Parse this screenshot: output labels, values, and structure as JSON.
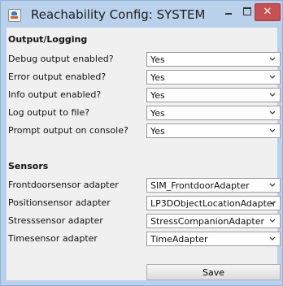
{
  "window": {
    "title": "Reachability Config: SYSTEM"
  },
  "titlebar": {
    "close_glyph": "✕"
  },
  "output_logging": {
    "heading": "Output/Logging",
    "rows": [
      {
        "label": "Debug output enabled?",
        "value": "Yes"
      },
      {
        "label": "Error output enabled?",
        "value": "Yes"
      },
      {
        "label": "Info output enabled?",
        "value": "Yes"
      },
      {
        "label": "Log output to file?",
        "value": "Yes"
      },
      {
        "label": "Prompt output on console?",
        "value": "Yes"
      }
    ]
  },
  "sensors": {
    "heading": "Sensors",
    "rows": [
      {
        "label": "Frontdoorsensor adapter",
        "value": "SIM_FrontdoorAdapter"
      },
      {
        "label": "Positionsensor adapter",
        "value": "LP3DObjectLocationAdapter"
      },
      {
        "label": "Stresssensor adapter",
        "value": "StressCompanionAdapter"
      },
      {
        "label": "Timesensor adapter",
        "value": "TimeAdapter"
      }
    ]
  },
  "actions": {
    "save_label": "Save"
  },
  "colors": {
    "title_bar": "#b9d1ea",
    "close_button": "#c75050",
    "panel": "#f0f0f0"
  }
}
